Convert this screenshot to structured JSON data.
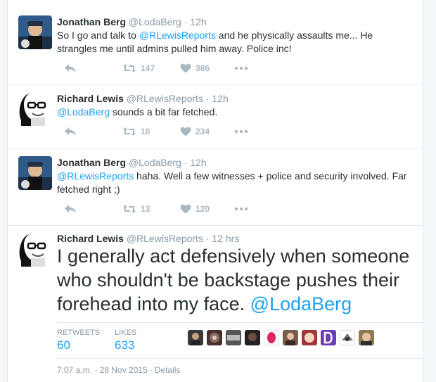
{
  "tweets": [
    {
      "name": "Jonathan Berg",
      "handle": "@LodaBerg",
      "time": "12h",
      "text_a": "So I go and talk to ",
      "mention_a": "@RLewisReports",
      "text_b": " and he physically assaults me... He strangles me until admins pulled him away. Police inc!",
      "retweets": "147",
      "likes": "386"
    },
    {
      "name": "Richard Lewis",
      "handle": "@RLewisReports",
      "time": "12h",
      "mention_a": "@LodaBerg",
      "text_b": " sounds a bit far fetched.",
      "retweets": "10",
      "likes": "234"
    },
    {
      "name": "Jonathan Berg",
      "handle": "@LodaBerg",
      "time": "12h",
      "mention_a": "@RLewisReports",
      "text_b": " haha. Well a few witnesses + police and security involved. Far fetched right ;)",
      "retweets": "13",
      "likes": "120"
    }
  ],
  "main_tweet": {
    "name": "Richard Lewis",
    "handle": "@RLewisReports",
    "time": "12 hrs",
    "text": "I generally act defensively when someone who shouldn't be backstage pushes their forehead into my face. ",
    "mention": "@LodaBerg",
    "retweets_label": "RETWEETS",
    "retweets": "60",
    "likes_label": "LIKES",
    "likes": "633",
    "timestamp": "7:07 a.m. - 28 Nov 2015",
    "details": "Details"
  },
  "icons": {
    "reply": "reply-icon",
    "retweet": "retweet-icon",
    "like": "heart-icon",
    "more": "more-icon"
  },
  "colors": {
    "link": "#1da1f2",
    "muted": "#8899a6",
    "action": "#aab8c2",
    "text": "#292f33"
  }
}
